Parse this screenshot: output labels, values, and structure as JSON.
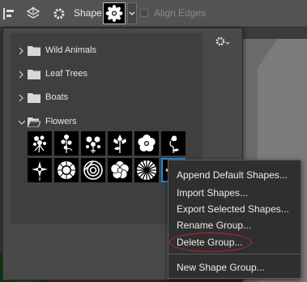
{
  "toolbar": {
    "shape_label": "Shape:",
    "align_edges_label": "Align Edges"
  },
  "panel": {
    "groups": [
      {
        "label": "Wild Animals",
        "expanded": false
      },
      {
        "label": "Leaf Trees",
        "expanded": false
      },
      {
        "label": "Boats",
        "expanded": false
      },
      {
        "label": "Flowers",
        "expanded": true
      }
    ],
    "flower_shapes": [
      "flower-1",
      "flower-2",
      "flower-3",
      "flower-4",
      "flower-5",
      "flower-6",
      "flower-7",
      "flower-8",
      "flower-9",
      "flower-10",
      "flower-11",
      "flower-12"
    ],
    "selected_shape": "flower-12"
  },
  "context_menu": {
    "items": [
      "Append Default Shapes...",
      "Import Shapes...",
      "Export Selected Shapes...",
      "Rename Group...",
      "Delete Group...",
      "New Shape Group..."
    ],
    "highlighted": "Delete Group...",
    "annotation_color": "#c4242a"
  },
  "colors": {
    "selection": "#1e8ad6"
  }
}
